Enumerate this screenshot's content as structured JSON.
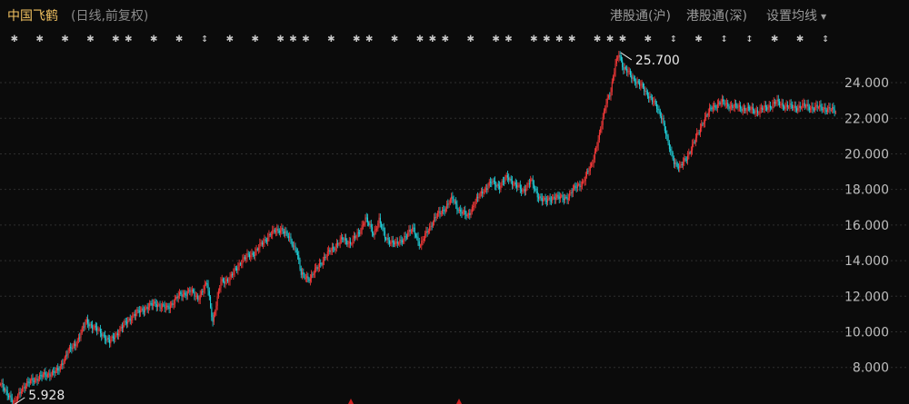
{
  "header": {
    "title": "中国飞鹤",
    "subtitle": "(日线,前复权)",
    "btn_hk_sh": "港股通(沪)",
    "btn_hk_sz": "港股通(深)",
    "btn_ma": "设置均线"
  },
  "colors": {
    "up": "#ff3b3b",
    "down": "#21d6e0",
    "grid": "#2f2f2f",
    "bg": "#0b0b0b",
    "event_marker": "#d02020"
  },
  "chart_data": {
    "type": "candlestick",
    "title": "",
    "xlabel": "",
    "ylabel": "",
    "ylim": [
      6.2,
      26.4
    ],
    "yticks": [
      "8.000",
      "10.000",
      "12.000",
      "14.000",
      "16.000",
      "18.000",
      "20.000",
      "22.000",
      "24.000"
    ],
    "grid": true,
    "annotations": {
      "max_label": "25.700",
      "min_label": "5.928"
    },
    "event_markers": "✱ ✱ ✱ ✱ ✱✱ ✱ ✱ ↕ ✱ ✱ ✱✱✱ ✱ ✱✱ ✱ ✱✱✱ ✱ ✱✱ ✱✱✱✱ ✱✱✱ ✱ ↕ ✱ ↕ ↕ ✱ ✱ ↕",
    "path_keypoints": [
      [
        0,
        7.0
      ],
      [
        8,
        6.4
      ],
      [
        12,
        5.93
      ],
      [
        18,
        6.8
      ],
      [
        28,
        7.3
      ],
      [
        40,
        7.6
      ],
      [
        50,
        7.8
      ],
      [
        58,
        8.8
      ],
      [
        66,
        9.4
      ],
      [
        75,
        10.6
      ],
      [
        80,
        10.3
      ],
      [
        90,
        9.8
      ],
      [
        95,
        9.4
      ],
      [
        105,
        10.2
      ],
      [
        115,
        10.9
      ],
      [
        125,
        11.3
      ],
      [
        135,
        11.6
      ],
      [
        145,
        11.3
      ],
      [
        155,
        12.0
      ],
      [
        165,
        12.3
      ],
      [
        172,
        11.9
      ],
      [
        180,
        12.7
      ],
      [
        185,
        10.6
      ],
      [
        192,
        12.8
      ],
      [
        200,
        13.0
      ],
      [
        210,
        14.0
      ],
      [
        222,
        14.5
      ],
      [
        235,
        15.5
      ],
      [
        245,
        15.8
      ],
      [
        252,
        15.2
      ],
      [
        258,
        14.6
      ],
      [
        262,
        13.2
      ],
      [
        270,
        13.0
      ],
      [
        278,
        13.8
      ],
      [
        288,
        14.6
      ],
      [
        298,
        15.2
      ],
      [
        305,
        15.0
      ],
      [
        312,
        15.5
      ],
      [
        318,
        16.4
      ],
      [
        325,
        15.5
      ],
      [
        330,
        16.3
      ],
      [
        335,
        15.3
      ],
      [
        345,
        14.9
      ],
      [
        355,
        15.5
      ],
      [
        360,
        15.8
      ],
      [
        366,
        14.8
      ],
      [
        372,
        15.7
      ],
      [
        380,
        16.5
      ],
      [
        388,
        17.0
      ],
      [
        394,
        17.5
      ],
      [
        400,
        16.8
      ],
      [
        407,
        16.5
      ],
      [
        413,
        17.2
      ],
      [
        420,
        17.9
      ],
      [
        428,
        18.4
      ],
      [
        435,
        18.2
      ],
      [
        442,
        18.7
      ],
      [
        448,
        18.3
      ],
      [
        455,
        17.9
      ],
      [
        462,
        18.5
      ],
      [
        468,
        17.7
      ],
      [
        475,
        17.3
      ],
      [
        482,
        17.6
      ],
      [
        488,
        17.5
      ],
      [
        495,
        17.6
      ],
      [
        502,
        18.2
      ],
      [
        508,
        18.4
      ],
      [
        515,
        19.4
      ],
      [
        522,
        21.0
      ],
      [
        528,
        23.0
      ],
      [
        532,
        23.5
      ],
      [
        536,
        25.0
      ],
      [
        539,
        25.7
      ],
      [
        543,
        24.8
      ],
      [
        548,
        24.5
      ],
      [
        555,
        24.0
      ],
      [
        560,
        23.7
      ],
      [
        566,
        23.2
      ],
      [
        572,
        22.6
      ],
      [
        577,
        22.0
      ],
      [
        582,
        20.5
      ],
      [
        587,
        19.6
      ],
      [
        592,
        19.2
      ],
      [
        598,
        19.8
      ],
      [
        605,
        20.7
      ],
      [
        612,
        21.8
      ],
      [
        620,
        22.6
      ],
      [
        628,
        22.9
      ],
      [
        636,
        22.7
      ],
      [
        644,
        22.6
      ],
      [
        652,
        22.5
      ],
      [
        660,
        22.4
      ],
      [
        668,
        22.6
      ],
      [
        676,
        22.9
      ],
      [
        684,
        22.7
      ],
      [
        692,
        22.6
      ],
      [
        700,
        22.7
      ],
      [
        708,
        22.6
      ],
      [
        716,
        22.6
      ],
      [
        722,
        22.5
      ],
      [
        728,
        22.4
      ]
    ]
  }
}
